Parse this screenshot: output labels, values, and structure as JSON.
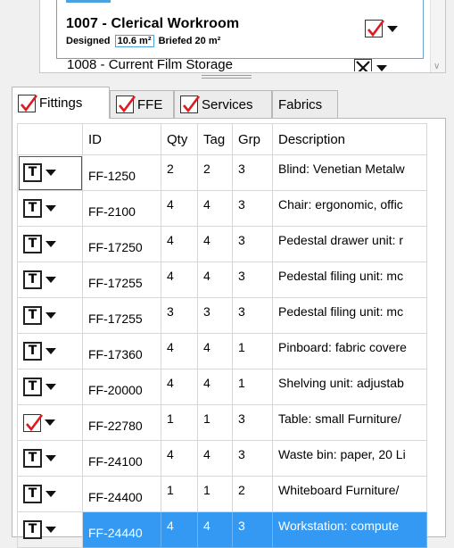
{
  "room_list": {
    "selected_room": {
      "title": "1007  -  Clerical Workroom",
      "designed_label": "Designed",
      "designed_value": "10.6 m²",
      "briefed_label": "Briefed",
      "briefed_value": "20 m²",
      "status": "checked-red"
    },
    "next_room": {
      "title": "1008  -  Current Film Storage",
      "status": "crossed"
    }
  },
  "tabs": [
    {
      "label": "Fittings",
      "has_check": true,
      "active": true
    },
    {
      "label": "FFE",
      "has_check": true,
      "active": false
    },
    {
      "label": "Services",
      "has_check": true,
      "active": false
    },
    {
      "label": "Fabrics",
      "has_check": false,
      "active": false
    }
  ],
  "grid": {
    "columns": [
      "",
      "ID",
      "Qty",
      "Tag",
      "Grp",
      "Description"
    ],
    "rows": [
      {
        "type": "T",
        "id": "FF-1250",
        "qty": "2",
        "tag": "2",
        "grp": "3",
        "desc": "Blind: Venetian Metalw"
      },
      {
        "type": "T",
        "id": "FF-2100",
        "qty": "4",
        "tag": "4",
        "grp": "3",
        "desc": "Chair: ergonomic, offic"
      },
      {
        "type": "T",
        "id": "FF-17250",
        "qty": "4",
        "tag": "4",
        "grp": "3",
        "desc": "Pedestal drawer unit: r"
      },
      {
        "type": "T",
        "id": "FF-17255",
        "qty": "4",
        "tag": "4",
        "grp": "3",
        "desc": "Pedestal filing unit: mc"
      },
      {
        "type": "T",
        "id": "FF-17255",
        "qty": "3",
        "tag": "3",
        "grp": "3",
        "desc": "Pedestal filing unit: mc"
      },
      {
        "type": "T",
        "id": "FF-17360",
        "qty": "4",
        "tag": "4",
        "grp": "1",
        "desc": "Pinboard: fabric covere"
      },
      {
        "type": "T",
        "id": "FF-20000",
        "qty": "4",
        "tag": "4",
        "grp": "1",
        "desc": "Shelving unit: adjustab"
      },
      {
        "type": "check",
        "id": "FF-22780",
        "qty": "1",
        "tag": "1",
        "grp": "3",
        "desc": "Table: small Furniture/"
      },
      {
        "type": "T",
        "id": "FF-24100",
        "qty": "4",
        "tag": "4",
        "grp": "3",
        "desc": "Waste bin: paper, 20 Li"
      },
      {
        "type": "T",
        "id": "FF-24400",
        "qty": "1",
        "tag": "1",
        "grp": "2",
        "desc": "Whiteboard Furniture/"
      },
      {
        "type": "T",
        "id": "FF-24440",
        "qty": "4",
        "tag": "4",
        "grp": "3",
        "desc": "Workstation: compute"
      }
    ],
    "selected_row": 10
  },
  "colors": {
    "selection": "#3399f3",
    "check_red": "#e0191f"
  },
  "icons": {
    "check": "red-check-icon",
    "cross": "x-box-icon",
    "dropdown": "caret-down-icon"
  }
}
